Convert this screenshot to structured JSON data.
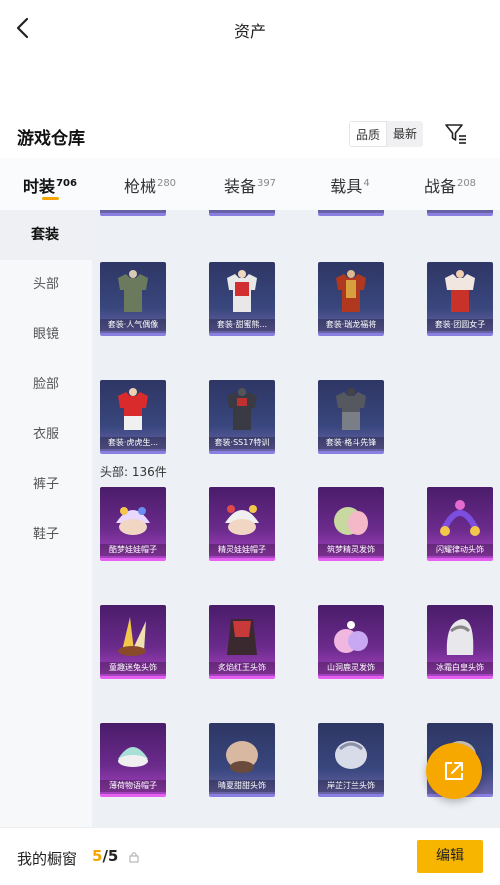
{
  "header": {
    "title": "资产"
  },
  "warehouse": {
    "title": "游戏仓库",
    "sort_options": [
      "品质",
      "最新"
    ],
    "active_sort": 0
  },
  "tabs": [
    {
      "label": "时装",
      "count": "706",
      "active": true
    },
    {
      "label": "枪械",
      "count": "280",
      "active": false
    },
    {
      "label": "装备",
      "count": "397",
      "active": false
    },
    {
      "label": "载具",
      "count": "4",
      "active": false
    },
    {
      "label": "战备",
      "count": "208",
      "active": false
    }
  ],
  "sidebar": {
    "items": [
      {
        "label": "套装",
        "active": true
      },
      {
        "label": "头部",
        "active": false
      },
      {
        "label": "眼镜",
        "active": false
      },
      {
        "label": "脸部",
        "active": false
      },
      {
        "label": "衣服",
        "active": false
      },
      {
        "label": "裤子",
        "active": false
      },
      {
        "label": "鞋子",
        "active": false
      }
    ]
  },
  "suits": [
    {
      "name": "套装·人气偶像",
      "rarity": "blue",
      "icon": "outfit-icon"
    },
    {
      "name": "套装·甜蜜熊...",
      "rarity": "blue",
      "icon": "outfit-icon"
    },
    {
      "name": "套装·瑞龙福将",
      "rarity": "blue",
      "icon": "outfit-icon"
    },
    {
      "name": "套装·团圆女子",
      "rarity": "blue",
      "icon": "outfit-icon"
    },
    {
      "name": "套装·虎虎生...",
      "rarity": "blue",
      "icon": "outfit-icon"
    },
    {
      "name": "套装·SS17特训",
      "rarity": "blue",
      "icon": "outfit-icon"
    },
    {
      "name": "套装·格斗先锋",
      "rarity": "blue",
      "icon": "outfit-icon"
    }
  ],
  "head_group": {
    "label": "头部: 136件",
    "items": [
      {
        "name": "酷梦娃娃帽子",
        "rarity": "pink",
        "icon": "hat-icon"
      },
      {
        "name": "精灵娃娃帽子",
        "rarity": "pink",
        "icon": "hat-icon"
      },
      {
        "name": "筑梦精灵发饰",
        "rarity": "pink",
        "icon": "hat-icon"
      },
      {
        "name": "闪耀律动头饰",
        "rarity": "pink",
        "icon": "hat-icon"
      },
      {
        "name": "童趣迷兔头饰",
        "rarity": "pink",
        "icon": "hat-icon"
      },
      {
        "name": "炙焰红王头饰",
        "rarity": "pink",
        "icon": "hat-icon"
      },
      {
        "name": "山洞鹿灵发饰",
        "rarity": "pink",
        "icon": "hat-icon"
      },
      {
        "name": "冰霜白皇头饰",
        "rarity": "pink",
        "icon": "hat-icon"
      },
      {
        "name": "薄荷物语帽子",
        "rarity": "pink",
        "icon": "hat-icon"
      },
      {
        "name": "晴夏甜甜头饰",
        "rarity": "blue",
        "icon": "hat-icon"
      },
      {
        "name": "岸芷汀兰头饰",
        "rarity": "blue",
        "icon": "hat-icon"
      },
      {
        "name": "",
        "rarity": "blue",
        "icon": "hat-icon"
      }
    ]
  },
  "closet": {
    "label": "我的橱窗",
    "current": "5",
    "total": "/5",
    "edit_label": "编辑"
  },
  "colors": {
    "accent": "#f5a500",
    "button": "#f7b500",
    "rarity_blue": "#8a7fe0",
    "rarity_pink": "#e55ff0"
  }
}
